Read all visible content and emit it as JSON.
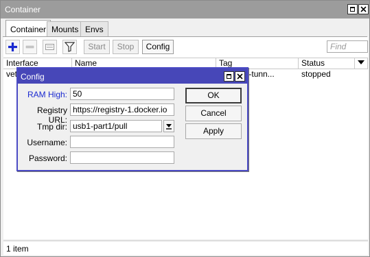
{
  "window": {
    "title": "Container"
  },
  "tabs": [
    {
      "label": "Container",
      "active": true
    },
    {
      "label": "Mounts",
      "active": false
    },
    {
      "label": "Envs",
      "active": false
    }
  ],
  "toolbar": {
    "start_label": "Start",
    "stop_label": "Stop",
    "config_label": "Config",
    "find_placeholder": "Find",
    "icons": [
      "add-icon",
      "remove-icon",
      "comment-icon",
      "filter-icon"
    ]
  },
  "table": {
    "columns": [
      "Interface",
      "Name",
      "Tag",
      "Status"
    ],
    "rows": [
      {
        "interface": "veth",
        "name": "",
        "tag": "ziti-edge-tunn...",
        "status": "stopped"
      }
    ]
  },
  "status_bar": {
    "text": "1 item"
  },
  "dialog": {
    "title": "Config",
    "fields": {
      "ram_high": {
        "label": "RAM High:",
        "value": "50"
      },
      "registry_url": {
        "label": "Registry URL:",
        "value": "https://registry-1.docker.io"
      },
      "tmp_dir": {
        "label": "Tmp dir:",
        "value": "usb1-part1/pull"
      },
      "username": {
        "label": "Username:",
        "value": ""
      },
      "password": {
        "label": "Password:",
        "value": ""
      }
    },
    "buttons": {
      "ok": "OK",
      "cancel": "Cancel",
      "apply": "Apply"
    }
  },
  "colors": {
    "dialog_title_bg": "#4747b8",
    "window_title_bg": "#9c9c9c",
    "highlight_label": "#1a2ad0",
    "add_icon": "#1a2ad0"
  }
}
